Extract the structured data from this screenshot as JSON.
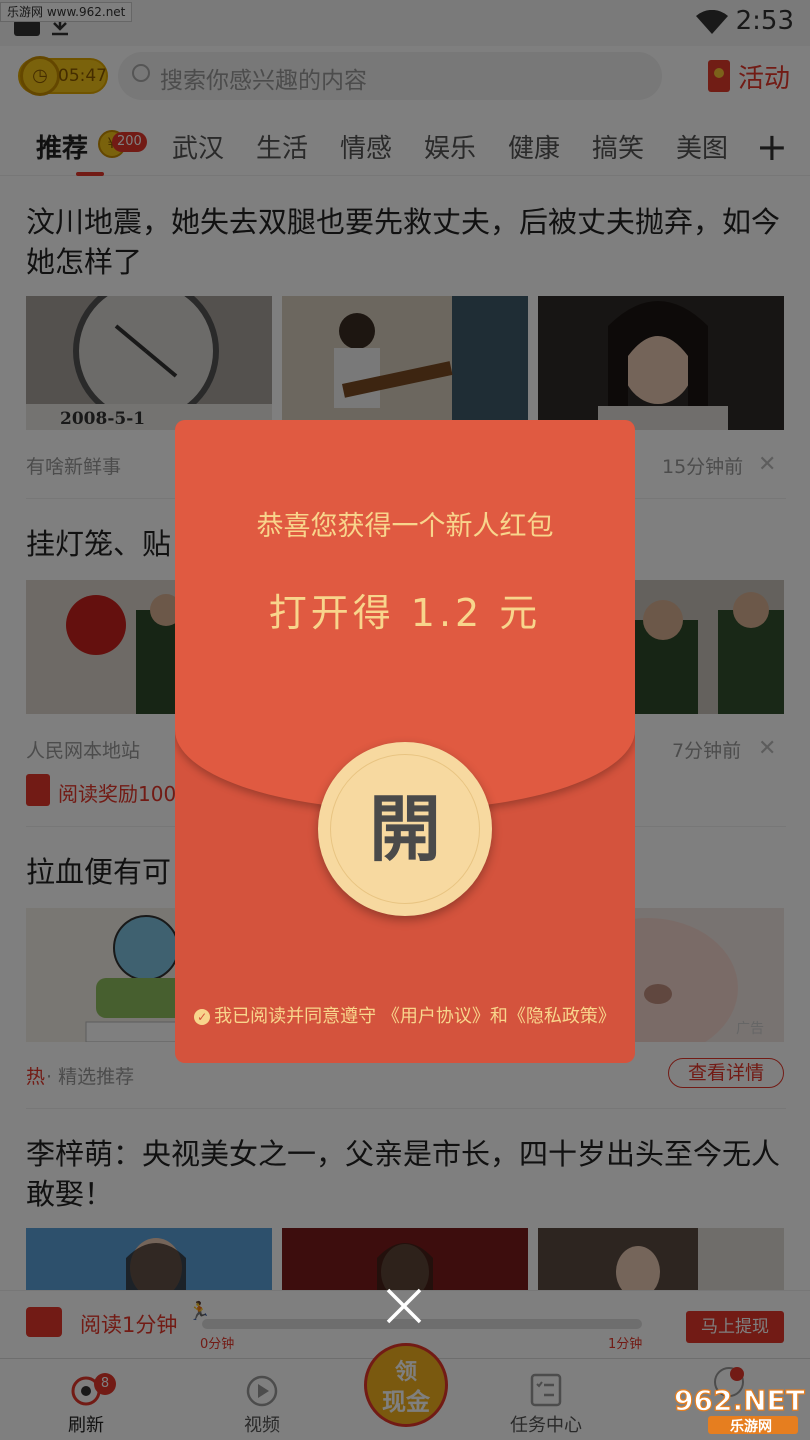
{
  "watermark_top": "乐游网 www.962.net",
  "status": {
    "time": "2:53"
  },
  "header": {
    "timer": "05:47",
    "search_placeholder": "搜索你感兴趣的内容",
    "activity_label": "活动"
  },
  "tabs": {
    "items": [
      "推荐",
      "武汉",
      "生活",
      "情感",
      "娱乐",
      "健康",
      "搞笑",
      "美图"
    ],
    "badge": "200"
  },
  "feed": [
    {
      "title": "汶川地震，她失去双腿也要先救丈夫，后被丈夫抛弃，如今她怎样了",
      "source": "有啥新鲜事",
      "time": "15分钟前",
      "photo_caption": "2008-5-1"
    },
    {
      "title": "挂灯笼、贴",
      "source": "人民网本地站",
      "time": "7分钟前",
      "reward": "阅读奖励100"
    },
    {
      "title": "拉血便有可",
      "hot": "热",
      "tag": "· 精选推荐",
      "action": "查看详情",
      "ad": "广告"
    },
    {
      "title": "李梓萌：央视美女之一，父亲是市长，四十岁出头至今无人敢娶！"
    }
  ],
  "reading": {
    "label": "阅读1分钟",
    "start": "0分钟",
    "end": "1分钟",
    "progress": 0,
    "withdraw": "马上提现"
  },
  "nav": {
    "refresh": "刷新",
    "refresh_badge": "8",
    "video": "视频",
    "cash_top": "领",
    "cash_bottom": "现金",
    "tasks": "任务中心"
  },
  "redpacket": {
    "title": "恭喜您获得一个新人红包",
    "amount": "打开得 1.2 元",
    "open_char": "開",
    "agreement": "我已阅读并同意遵守 《用户协议》和《隐私政策》"
  },
  "watermark_logo": {
    "main": "962.NET",
    "sub": "乐游网"
  },
  "colors": {
    "accent": "#e5372a",
    "packet": "#d4533d",
    "gold": "#f8d58c"
  }
}
